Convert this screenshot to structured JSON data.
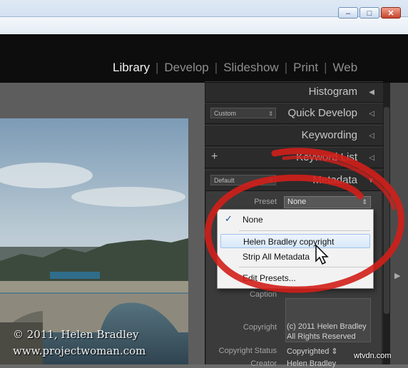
{
  "modules": {
    "items": [
      {
        "label": "Library",
        "active": true
      },
      {
        "label": "Develop",
        "active": false
      },
      {
        "label": "Slideshow",
        "active": false
      },
      {
        "label": "Print",
        "active": false
      },
      {
        "label": "Web",
        "active": false
      }
    ]
  },
  "window_buttons": {
    "minimize": "–",
    "maximize": "□",
    "close": "✕"
  },
  "panels": {
    "histogram": "Histogram",
    "quick_develop": {
      "title": "Quick Develop",
      "preset": "Custom"
    },
    "keywording": "Keywording",
    "keyword_list": {
      "title": "Keyword List",
      "plus": "+"
    },
    "metadata": {
      "title": "Metadata",
      "preset": "Default"
    }
  },
  "metadata_fields": {
    "preset_label": "Preset",
    "preset_value": "None",
    "caption_label": "Caption",
    "copyright_label": "Copyright",
    "copyright_value_line1": "(c) 2011 Helen Bradley",
    "copyright_value_line2": "All Rights Reserved",
    "copyright_status_label": "Copyright Status",
    "copyright_status_value": "Copyrighted",
    "creator_label": "Creator",
    "creator_value": "Helen Bradley"
  },
  "preset_menu": {
    "items": [
      "None",
      "Helen Bradley copyright",
      "Strip All Metadata",
      "Edit Presets..."
    ],
    "checked_index": 0,
    "hovered_index": 1
  },
  "photo": {
    "credit_line1": "© 2011, Helen Bradley",
    "credit_line2": "www.projectwoman.com"
  },
  "watermark": "wtvdn.com",
  "colors": {
    "accent_red": "#d21f1a",
    "panel_bg": "#2b2b2b",
    "module_active": "#f2f2f2",
    "module_inactive": "#8e8e8e"
  }
}
